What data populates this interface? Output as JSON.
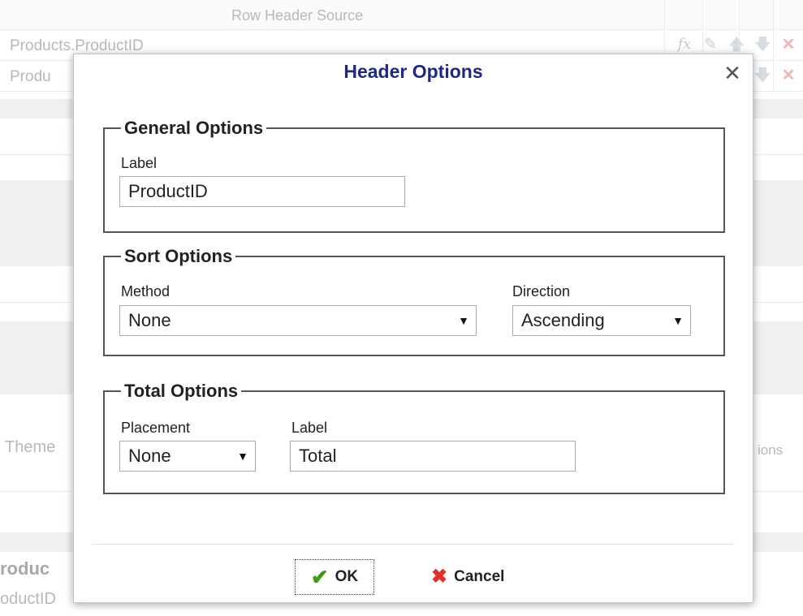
{
  "background": {
    "column_header": "Row Header Source",
    "rows": [
      "Products.ProductID",
      "Produ"
    ],
    "row_icons": [
      "function-icon",
      "edit-icon",
      "up-arrow-icon",
      "down-arrow-icon",
      "delete-icon"
    ],
    "theme_label": "Theme",
    "options_label": "ions",
    "section_label": "roduc",
    "footer_label": "oductID"
  },
  "dialog": {
    "title": "Header Options",
    "general": {
      "legend": "General Options",
      "label_caption": "Label",
      "label_value": "ProductID"
    },
    "sort": {
      "legend": "Sort Options",
      "method_caption": "Method",
      "method_value": "None",
      "direction_caption": "Direction",
      "direction_value": "Ascending"
    },
    "total": {
      "legend": "Total Options",
      "placement_caption": "Placement",
      "placement_value": "None",
      "label_caption": "Label",
      "label_value": "Total"
    },
    "buttons": {
      "ok": "OK",
      "cancel": "Cancel"
    }
  },
  "colors": {
    "title": "#1c2a86",
    "ok_check": "#3f9a1b",
    "cancel_cross": "#e0302a"
  }
}
